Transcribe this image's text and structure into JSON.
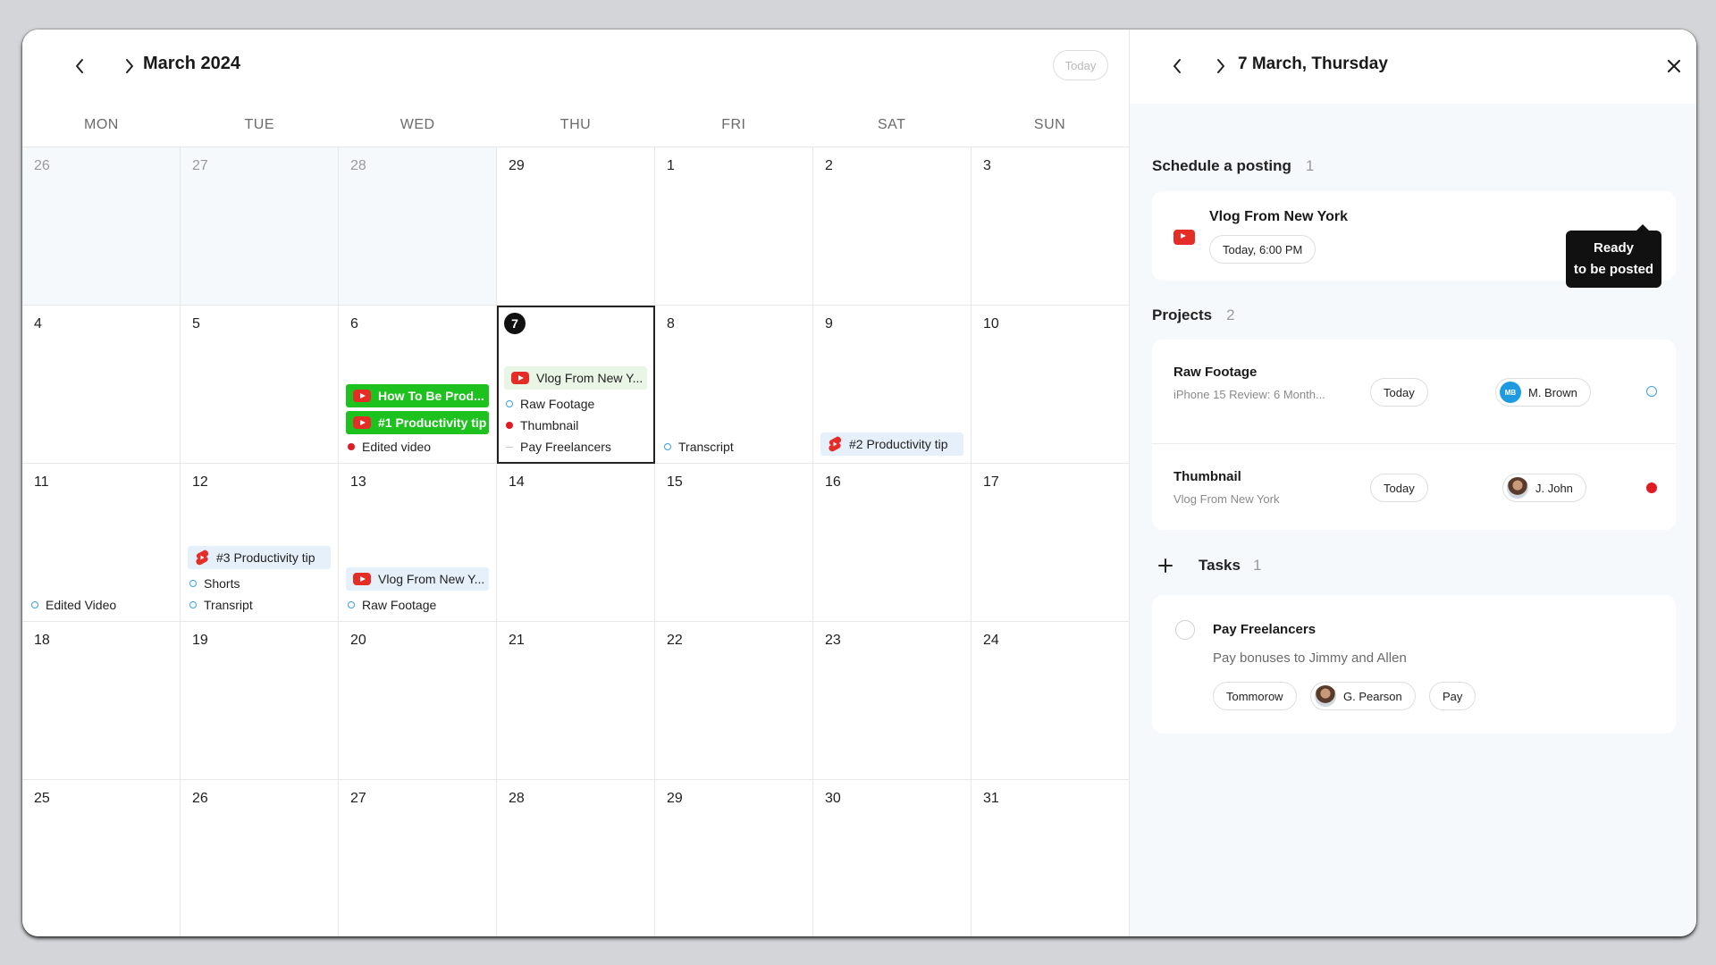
{
  "calendar": {
    "month_title": "March 2024",
    "today_label": "Today",
    "weekdays": [
      "MON",
      "TUE",
      "WED",
      "THU",
      "FRI",
      "SAT",
      "SUN"
    ],
    "days": [
      "26",
      "27",
      "28",
      "29",
      "1",
      "2",
      "3",
      "4",
      "5",
      "6",
      "7",
      "8",
      "9",
      "10",
      "11",
      "12",
      "13",
      "14",
      "15",
      "16",
      "17",
      "18",
      "19",
      "20",
      "21",
      "22",
      "23",
      "24",
      "25",
      "26",
      "27",
      "28",
      "29",
      "30",
      "31"
    ],
    "events": {
      "wed6": {
        "chip1": "How To Be Prod...",
        "chip2": "#1 Productivity tip",
        "item1": "Edited video"
      },
      "thu7": {
        "chip1": "Vlog From New Y...",
        "item1": "Raw Footage",
        "item2": "Thumbnail",
        "item3": "Pay Freelancers"
      },
      "fri8": {
        "item1": "Transcript"
      },
      "sat9": {
        "chip1": "#2 Productivity tip"
      },
      "mon11": {
        "item1": "Edited Video"
      },
      "tue12": {
        "chip1": "#3 Productivity tip",
        "item1": "Shorts",
        "item2": "Transript"
      },
      "wed13": {
        "chip1": "Vlog From New Y...",
        "item1": "Raw Footage"
      }
    }
  },
  "panel": {
    "title": "7 March, Thursday",
    "schedule": {
      "title": "Schedule a posting",
      "count": "1",
      "post_title": "Vlog From New York",
      "post_time": "Today, 6:00 PM",
      "tooltip_line1": "Ready",
      "tooltip_line2": "to be posted"
    },
    "projects": {
      "title": "Projects",
      "count": "2",
      "items": [
        {
          "title": "Raw Footage",
          "subtitle": "iPhone 15 Review: 6 Month...",
          "date": "Today",
          "assignee": "M. Brown",
          "initials": "MB"
        },
        {
          "title": "Thumbnail",
          "subtitle": "Vlog From New York",
          "date": "Today",
          "assignee": "J. John"
        }
      ]
    },
    "tasks": {
      "title": "Tasks",
      "count": "1",
      "items": [
        {
          "title": "Pay Freelancers",
          "description": "Pay bonuses to Jimmy and Allen",
          "date": "Tommorow",
          "assignee": "G. Pearson",
          "tag": "Pay"
        }
      ]
    }
  },
  "colors": {
    "accent_green": "#1ec21e",
    "youtube_red": "#e52d27",
    "status_blue": "#3aa0e6",
    "status_red": "#e01b24"
  }
}
